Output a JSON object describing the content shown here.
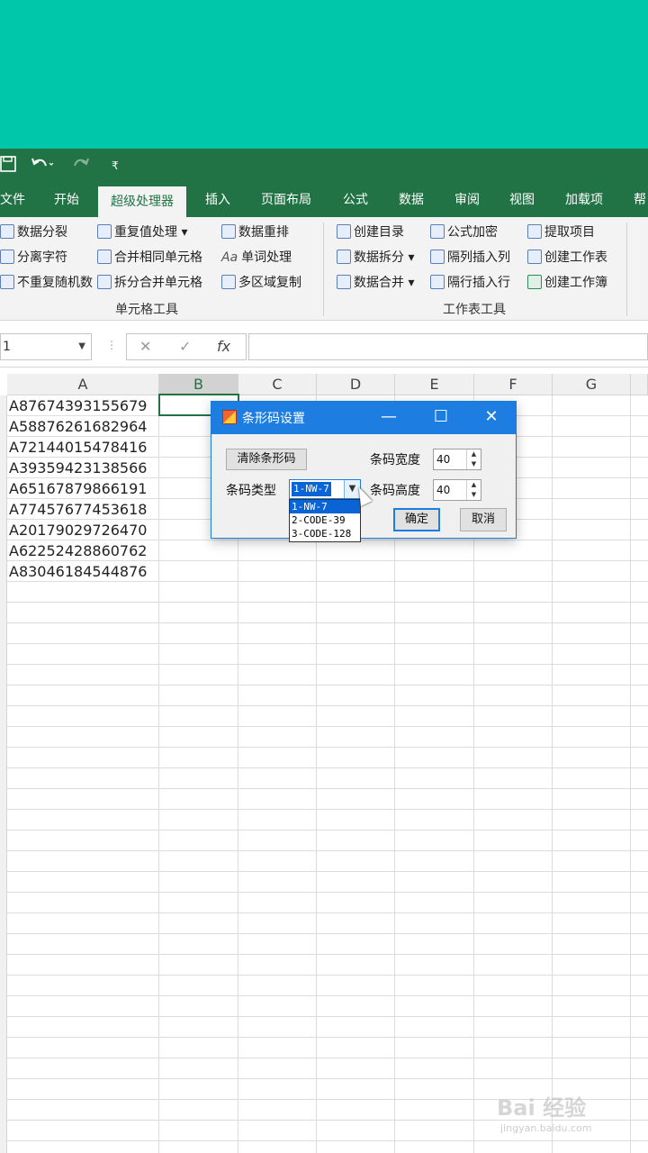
{
  "quick_access": {
    "save_icon": "save-icon",
    "undo_icon": "undo-icon",
    "redo_icon": "redo-icon",
    "customize": "₹"
  },
  "tabs": [
    "文件",
    "开始",
    "超级处理器",
    "插入",
    "页面布局",
    "公式",
    "数据",
    "审阅",
    "视图",
    "加载项",
    "帮"
  ],
  "ribbon": {
    "cell_tools": {
      "items": [
        "数据分裂",
        "分离字符",
        "不重复随机数",
        "重复值处理",
        "合并相同单元格",
        "拆分合并单元格",
        "数据重排",
        "单词处理",
        "多区域复制"
      ],
      "label": "单元格工具"
    },
    "sheet_tools": {
      "items": [
        "创建目录",
        "数据拆分",
        "数据合并",
        "公式加密",
        "隔列插入列",
        "隔行插入行",
        "提取项目",
        "创建工作表",
        "创建工作簿"
      ],
      "label": "工作表工具"
    },
    "aa_icon_text": "Aa"
  },
  "formula_bar": {
    "name_box": "1",
    "cancel": "✕",
    "enter": "✓",
    "fx": "fx"
  },
  "columns": [
    "A",
    "B",
    "C",
    "D",
    "E",
    "F",
    "G"
  ],
  "cells": [
    "A87674393155679",
    "A58876261682964",
    "A72144015478416",
    "A39359423138566",
    "A65167879866191",
    "A77457677453618",
    "A20179029726470",
    "A62252428860762",
    "A83046184544876"
  ],
  "dialog": {
    "title": "条形码设置",
    "clear_button": "清除条形码",
    "type_label": "条码类型",
    "type_value": "1-NW-7",
    "type_options": [
      "1-NW-7",
      "2-CODE-39",
      "3-CODE-128"
    ],
    "width_label": "条码宽度",
    "width_value": "40",
    "height_label": "条码高度",
    "height_value": "40",
    "ok": "确定",
    "cancel": "取消"
  },
  "watermark": {
    "main": "Bai 经验",
    "sub": "jingyan.baidu.com"
  }
}
